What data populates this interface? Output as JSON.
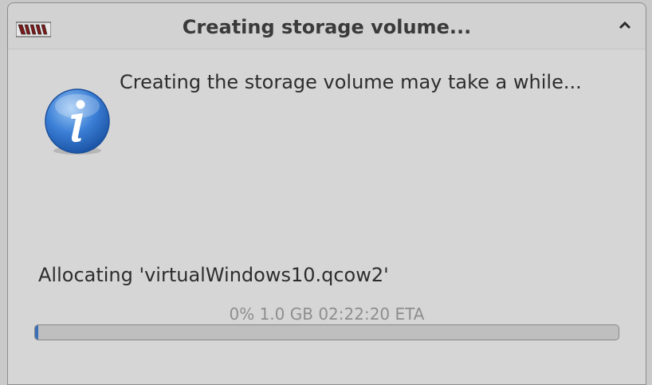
{
  "dialog": {
    "title": "Creating storage volume...",
    "message": "Creating the storage volume may take a while...",
    "allocating_text": "Allocating 'virtualWindows10.qcow2'",
    "progress": {
      "percent_text": "0%",
      "size_text": "1.0 GB",
      "eta_text": "02:22:20 ETA",
      "fraction": 0.006
    }
  },
  "icons": {
    "app_icon": "virt-manager-icon",
    "collapse_icon": "chevron-up-icon",
    "info_icon": "information-icon"
  },
  "colors": {
    "progress_fill": "#3a6fb8",
    "info_icon_blue": "#3b7fd6"
  }
}
